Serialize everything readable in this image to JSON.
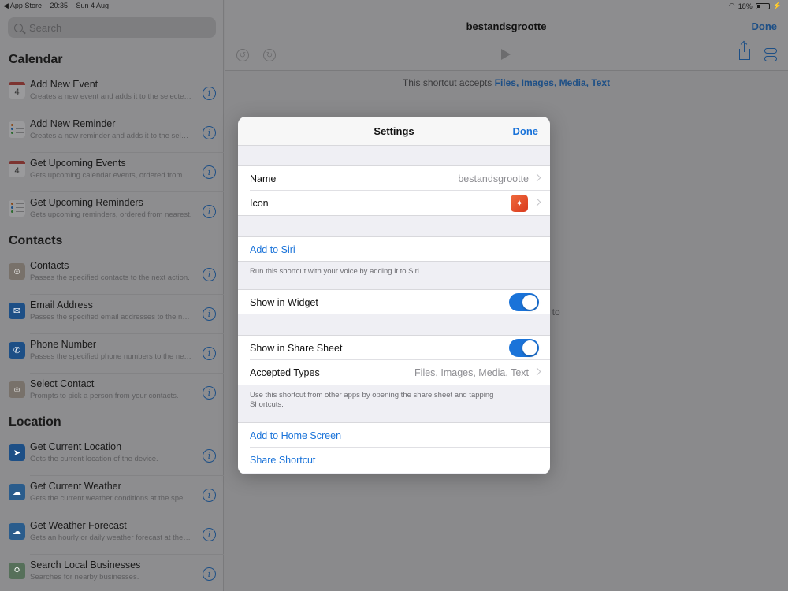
{
  "status_bar": {
    "back_app": "◀ App Store",
    "time": "20:35",
    "date": "Sun 4 Aug",
    "battery": "18%"
  },
  "sidebar": {
    "search_placeholder": "Search",
    "sections": [
      {
        "title": "Calendar",
        "items": [
          {
            "name": "Add New Event",
            "desc": "Creates a new event and adds it to the selected calendar.",
            "icon": "calendar-icon"
          },
          {
            "name": "Add New Reminder",
            "desc": "Creates a new reminder and adds it to the selected list.",
            "icon": "reminders-icon"
          },
          {
            "name": "Get Upcoming Events",
            "desc": "Gets upcoming calendar events, ordered from nearest.",
            "icon": "calendar-icon"
          },
          {
            "name": "Get Upcoming Reminders",
            "desc": "Gets upcoming reminders, ordered from nearest.",
            "icon": "reminders-icon"
          }
        ]
      },
      {
        "title": "Contacts",
        "items": [
          {
            "name": "Contacts",
            "desc": "Passes the specified contacts to the next action.",
            "icon": "contacts-icon"
          },
          {
            "name": "Email Address",
            "desc": "Passes the specified email addresses to the next action.",
            "icon": "mail-icon"
          },
          {
            "name": "Phone Number",
            "desc": "Passes the specified phone numbers to the next action.",
            "icon": "phone-icon"
          },
          {
            "name": "Select Contact",
            "desc": "Prompts to pick a person from your contacts.",
            "icon": "contacts-icon"
          }
        ]
      },
      {
        "title": "Location",
        "items": [
          {
            "name": "Get Current Location",
            "desc": "Gets the current location of the device.",
            "icon": "location-arrow-icon"
          },
          {
            "name": "Get Current Weather",
            "desc": "Gets the current weather conditions at the specified location.",
            "icon": "weather-icon"
          },
          {
            "name": "Get Weather Forecast",
            "desc": "Gets an hourly or daily weather forecast at the location.",
            "icon": "weather-icon"
          },
          {
            "name": "Search Local Businesses",
            "desc": "Searches for nearby businesses.",
            "icon": "maps-icon"
          }
        ]
      }
    ],
    "calendar_day": "4"
  },
  "main": {
    "title": "bestandsgrootte",
    "done_label": "Done",
    "accepts_prefix": "This shortcut accepts ",
    "accepts_types": "Files, Images, Media, Text",
    "background_hint": "t to"
  },
  "modal": {
    "title": "Settings",
    "done_label": "Done",
    "name_label": "Name",
    "name_value": "bestandsgrootte",
    "icon_label": "Icon",
    "add_to_siri": "Add to Siri",
    "siri_footer": "Run this shortcut with your voice by adding it to Siri.",
    "show_in_widget": "Show in Widget",
    "show_in_widget_on": true,
    "show_in_share_sheet": "Show in Share Sheet",
    "show_in_share_sheet_on": true,
    "accepted_types_label": "Accepted Types",
    "accepted_types_value": "Files, Images, Media, Text",
    "share_footer": "Use this shortcut from other apps by opening the share sheet and tapping Shortcuts.",
    "add_to_home_screen": "Add to Home Screen",
    "share_shortcut": "Share Shortcut"
  },
  "colors": {
    "accent": "#1a73d9",
    "dimmed_accent": "#1d4f86",
    "toggle_on": "#1a73d9"
  }
}
